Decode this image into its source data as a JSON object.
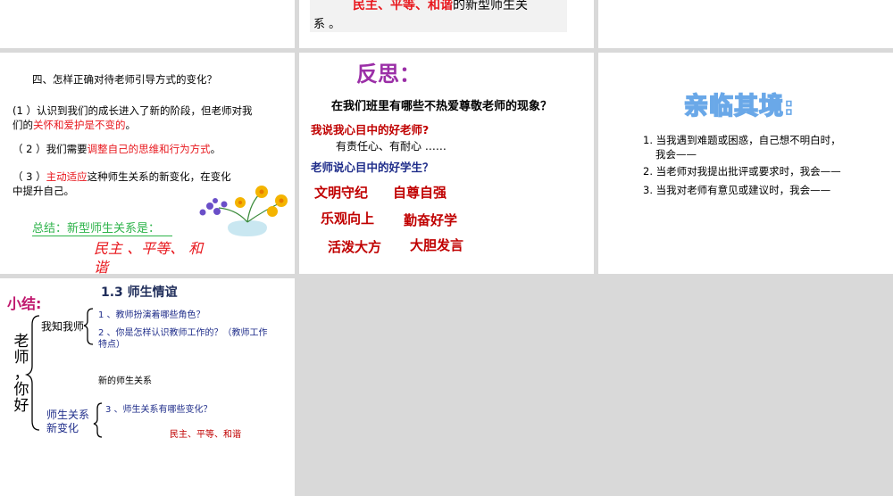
{
  "s1": {},
  "s2": {
    "l1_red": "民主、平等、和谐",
    "l1_rest": "的新型师生关",
    "l2": "系 。"
  },
  "s3": {},
  "s4": {
    "heading": "四、怎样正确对待老师引导方式的变化？",
    "p1_a": "(1 ）认识到我们的成长进入了新的阶段，但老师对我",
    "p1_b": "们的",
    "p1_red": "关怀和爱护是不变的",
    "p1_end": "。",
    "p2_a": "（ 2 ）我们需要",
    "p2_red": "调整自己的思维和行为方式",
    "p2_end": "。",
    "p3_a": "（ 3 ）",
    "p3_red": "主动适应",
    "p3_rest": "这种师生关系的新变化，在变化",
    "p3_b": "中提升自己。",
    "summary": "总结：新型师生关系是：",
    "answer_l1": "民主 、平等、 和",
    "answer_l2": "谐"
  },
  "s5": {
    "title": "反思：",
    "question": "在我们班里有哪些不热爱尊敬老师的现象？",
    "q1": "我说我心目中的好老师?",
    "a1": "有责任心、有耐心 ……",
    "q2": "老师说心目中的好学生？",
    "words": [
      "文明守纪",
      "自尊自强",
      "乐观向上",
      "勤奋好学",
      "活泼大方",
      "大胆发言"
    ]
  },
  "s6": {
    "title": "亲临其境:",
    "items": [
      {
        "num": "1.",
        "l1": "当我遇到难题或困惑，自己想不明白时，",
        "l2": "我会——"
      },
      {
        "num": "2.",
        "l1": "当老师对我提出批评或要求时，我会——",
        "l2": ""
      },
      {
        "num": "3.",
        "l1": "当我对老师有意见或建议时，我会——",
        "l2": ""
      }
    ]
  },
  "s7": {
    "label": "小结:",
    "title": "1.3   师生情谊",
    "vertical": [
      "老",
      "师",
      "，",
      "你",
      "好"
    ],
    "node1": "我知我师",
    "item1": "1 、教师扮演着哪些角色？",
    "item2a": "2 、你是怎样认识教师工作的？（教师工作",
    "item2b": "特点）",
    "item_new": "新的师生关系",
    "node2a": "师生关系",
    "node2b": "新变化",
    "item3": "3 、师生关系有哪些变化？",
    "item3_ans": "民主、平等、和谐"
  },
  "colors": {
    "red": "#e8181e",
    "blue": "#1f2d8a",
    "green": "#2db34a",
    "title_blue": "#6aa8e8"
  }
}
